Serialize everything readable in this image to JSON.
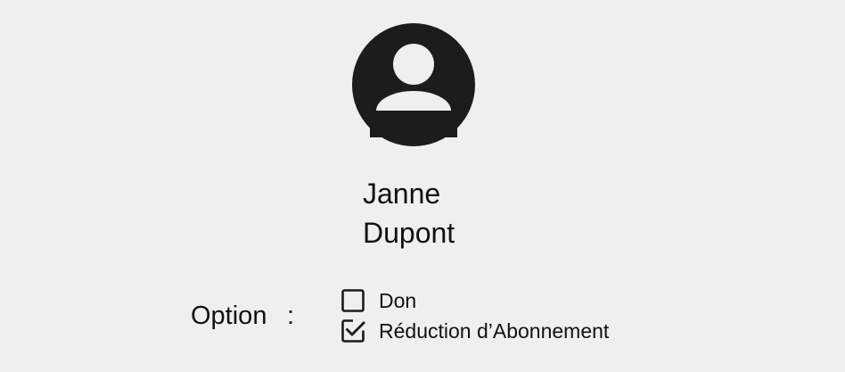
{
  "profile": {
    "avatar_icon": "account-circle-icon",
    "first_name": "Janne",
    "last_name": "Dupont"
  },
  "options": {
    "label": "Option",
    "separator": ":",
    "items": [
      {
        "label": "Don",
        "checked": false,
        "icon": "checkbox-unchecked-icon"
      },
      {
        "label": "Réduction d’Abonnement",
        "checked": true,
        "icon": "checkbox-checked-icon"
      }
    ]
  },
  "colors": {
    "background": "#efefef",
    "foreground": "#1c1c1c"
  }
}
